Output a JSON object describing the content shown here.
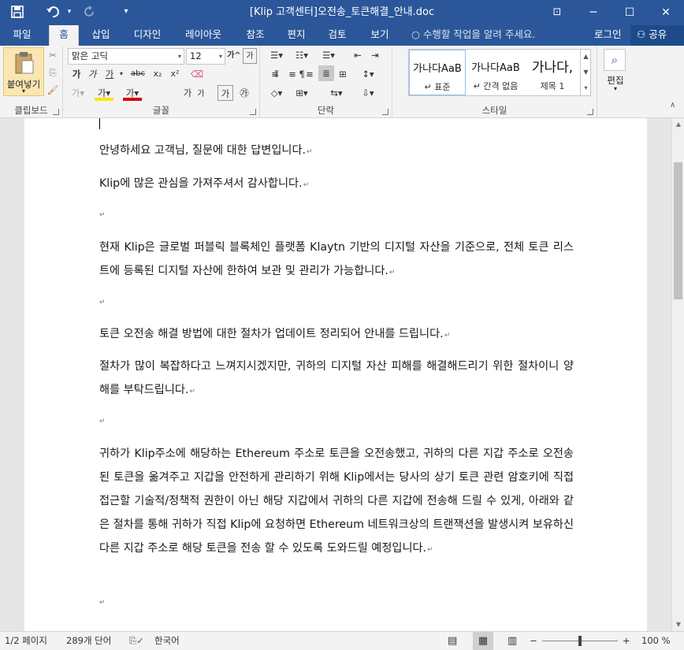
{
  "titlebar": {
    "title": "[Klip 고객센터]오전송_토큰해결_안내.doc",
    "undo_icon": "undo-icon",
    "redo_icon": "redo-icon",
    "save_icon": "save-icon"
  },
  "tabs": [
    "파일",
    "홈",
    "삽입",
    "디자인",
    "레이아웃",
    "참조",
    "편지",
    "검토",
    "보기"
  ],
  "active_tab": "홈",
  "tell_me": "수행할 작업을 알려 주세요.",
  "login": "로그인",
  "share": "공유",
  "ribbon": {
    "clipboard": {
      "paste": "붙여넣기",
      "label": "클립보드"
    },
    "font": {
      "name": "맑은 고딕",
      "size": "12",
      "label": "글꼴",
      "bold": "가",
      "italic": "가",
      "underline": "가",
      "strike": "abc",
      "sub": "x₂",
      "sup": "x²",
      "grow": "가",
      "shrink": "가",
      "case": "Aa",
      "clear": "가",
      "phonetic": "가",
      "enclose": "㉮"
    },
    "paragraph": {
      "label": "단락"
    },
    "styles": {
      "label": "스타일",
      "items": [
        {
          "sample": "가나다AaB",
          "name": "↵ 표준"
        },
        {
          "sample": "가나다AaB",
          "name": "↵ 간격 없음"
        },
        {
          "sample": "가나다,",
          "name": "제목 1"
        }
      ]
    },
    "editing": {
      "label": "편집"
    }
  },
  "document": {
    "paragraphs": [
      "안녕하세요 고객님, 질문에 대한 답변입니다.",
      "Klip에 많은 관심을 가져주셔서 감사합니다.",
      "",
      "현재 Klip은 글로벌 퍼블릭 블록체인 플랫폼 Klaytn 기반의 디지털 자산을 기준으로, 전체 토큰 리스트에 등록된 디지털 자산에 한하여 보관 및 관리가 가능합니다.",
      "",
      "토큰 오전송 해결 방법에 대한 절차가 업데이트 정리되어 안내를 드립니다.",
      "절차가 많이 복잡하다고 느껴지시겠지만, 귀하의 디지털 자산 피해를 해결해드리기 위한 절차이니 양해를 부탁드립니다.",
      "",
      "귀하가 Klip주소에 해당하는 Ethereum 주소로 토큰을 오전송했고, 귀하의 다른 지갑 주소로 오전송된 토큰을 옮겨주고 지갑을 안전하게 관리하기 위해 Klip에서는 당사의 상기 토큰 관련 암호키에 직접 접근할 기술적/정책적 권한이 아닌 해당 지갑에서 귀하의 다른 지갑에 전송해 드릴 수 있게, 아래와 같은 절차를 통해 귀하가 직접 Klip에 요청하면 Ethereum 네트워크상의 트랜잭션을 발생시켜 보유하신 다른 지갑 주소로 해당 토큰을 전송 할 수 있도록 도와드릴 예정입니다.",
      ""
    ]
  },
  "status": {
    "page": "1/2 페이지",
    "words": "289개 단어",
    "language": "한국어",
    "zoom": "100 %"
  }
}
